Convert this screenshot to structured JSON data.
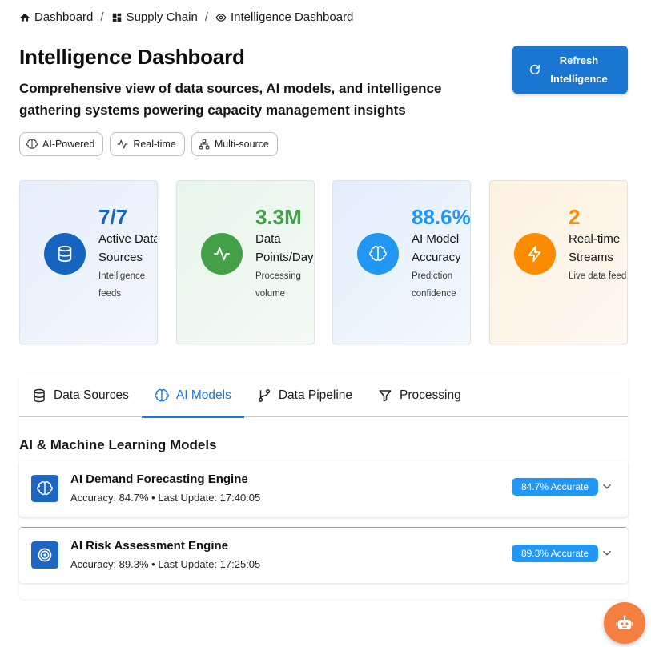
{
  "breadcrumb": [
    {
      "label": "Dashboard",
      "icon": "home-icon"
    },
    {
      "label": "Supply Chain",
      "icon": "grid-icon"
    },
    {
      "label": "Intelligence Dashboard",
      "icon": "eye-icon"
    }
  ],
  "header": {
    "title": "Intelligence Dashboard",
    "subtitle": "Comprehensive view of data sources, AI models, and intelligence gathering systems powering capacity management insights",
    "refresh_label": "Refresh Intelligence"
  },
  "chips": [
    {
      "label": "AI-Powered",
      "icon": "brain-icon"
    },
    {
      "label": "Real-time",
      "icon": "pulse-icon"
    },
    {
      "label": "Multi-source",
      "icon": "network-icon"
    }
  ],
  "stats": [
    {
      "value": "7/7",
      "label": "Active Data Sources",
      "sub": "Intelligence feeds",
      "color": "#1565c0",
      "icon": "database-icon"
    },
    {
      "value": "3.3M",
      "label": "Data Points/Day",
      "sub": "Processing volume",
      "color": "#43a047",
      "icon": "pulse-icon"
    },
    {
      "value": "88.6%",
      "label": "AI Model Accuracy",
      "sub": "Prediction confidence",
      "color": "#2196f3",
      "icon": "brain-icon"
    },
    {
      "value": "2",
      "label": "Real-time Streams",
      "sub": "Live data feeds",
      "color": "#fb8c00",
      "icon": "lightning-icon"
    }
  ],
  "tabs": [
    {
      "label": "Data Sources",
      "icon": "database-icon",
      "active": false
    },
    {
      "label": "AI Models",
      "icon": "brain-icon",
      "active": true
    },
    {
      "label": "Data Pipeline",
      "icon": "git-branch-icon",
      "active": false
    },
    {
      "label": "Processing",
      "icon": "filter-icon",
      "active": false
    }
  ],
  "models_section": {
    "title": "AI & Machine Learning Models",
    "models": [
      {
        "name": "AI Demand Forecasting Engine",
        "meta": "Accuracy: 84.7% • Last Update: 17:40:05",
        "badge": "84.7% Accurate",
        "icon": "brain-icon"
      },
      {
        "name": "AI Risk Assessment Engine",
        "meta": "Accuracy: 89.3% • Last Update: 17:25:05",
        "badge": "89.3% Accurate",
        "icon": "target-icon"
      }
    ]
  },
  "colors": {
    "primary": "#1976d2",
    "badge": "#2196f3",
    "fab": "#f47f41"
  }
}
